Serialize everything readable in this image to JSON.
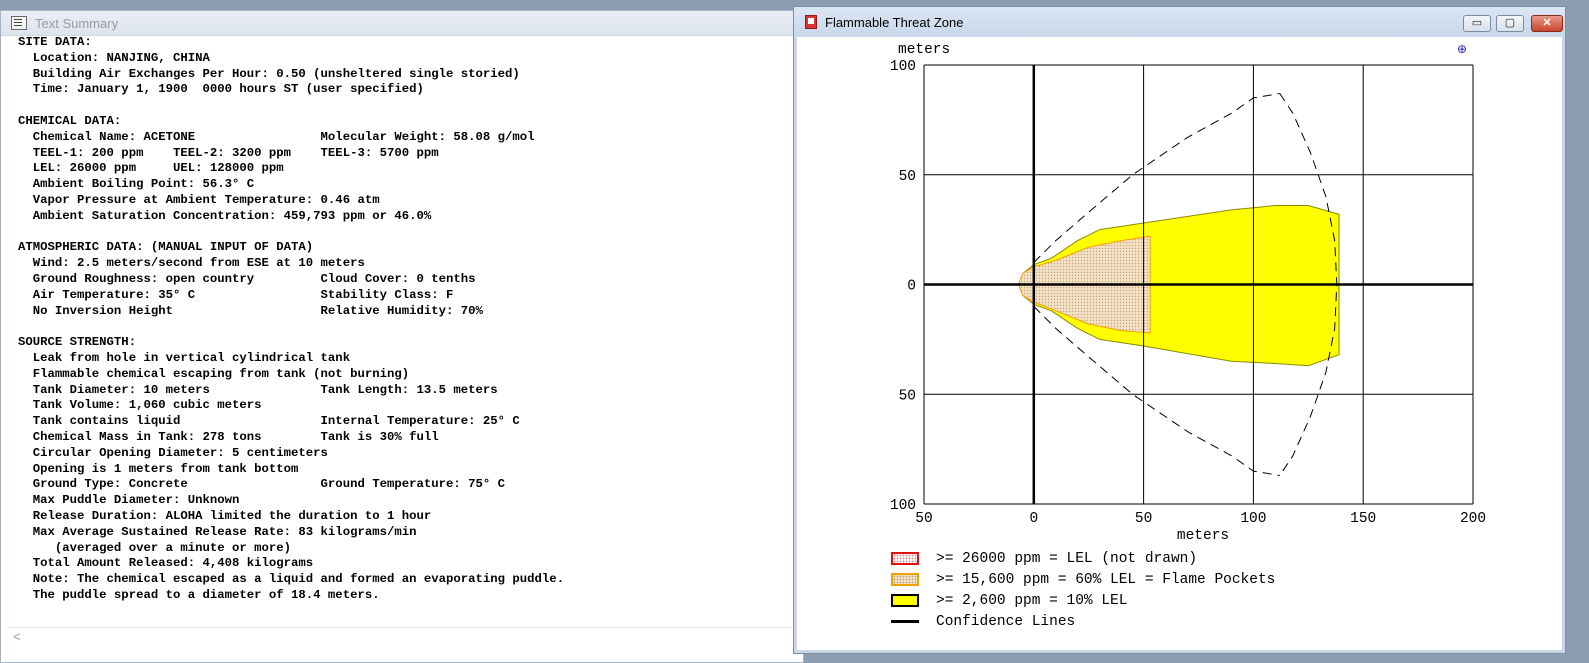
{
  "text_summary": {
    "title": "Text Summary",
    "report": "SITE DATA:\n  Location: NANJING, CHINA\n  Building Air Exchanges Per Hour: 0.50 (unsheltered single storied)\n  Time: January 1, 1900  0000 hours ST (user specified)\n\nCHEMICAL DATA:\n  Chemical Name: ACETONE                 Molecular Weight: 58.08 g/mol\n  TEEL-1: 200 ppm    TEEL-2: 3200 ppm    TEEL-3: 5700 ppm\n  LEL: 26000 ppm     UEL: 128000 ppm\n  Ambient Boiling Point: 56.3° C\n  Vapor Pressure at Ambient Temperature: 0.46 atm\n  Ambient Saturation Concentration: 459,793 ppm or 46.0%\n\nATMOSPHERIC DATA: (MANUAL INPUT OF DATA)\n  Wind: 2.5 meters/second from ESE at 10 meters\n  Ground Roughness: open country         Cloud Cover: 0 tenths\n  Air Temperature: 35° C                 Stability Class: F\n  No Inversion Height                    Relative Humidity: 70%\n\nSOURCE STRENGTH:\n  Leak from hole in vertical cylindrical tank\n  Flammable chemical escaping from tank (not burning)\n  Tank Diameter: 10 meters               Tank Length: 13.5 meters\n  Tank Volume: 1,060 cubic meters\n  Tank contains liquid                   Internal Temperature: 25° C\n  Chemical Mass in Tank: 278 tons        Tank is 30% full\n  Circular Opening Diameter: 5 centimeters\n  Opening is 1 meters from tank bottom\n  Ground Type: Concrete                  Ground Temperature: 75° C\n  Max Puddle Diameter: Unknown\n  Release Duration: ALOHA limited the duration to 1 hour\n  Max Average Sustained Release Rate: 83 kilograms/min\n     (averaged over a minute or more)\n  Total Amount Released: 4,408 kilograms\n  Note: The chemical escaped as a liquid and formed an evaporating puddle.\n  The puddle spread to a diameter of 18.4 meters.",
    "scroll_left_glyph": "<"
  },
  "threat_zone": {
    "title": "Flammable Threat Zone",
    "controls": {
      "minimize": "▭",
      "maximize": "▢",
      "close": "✕"
    },
    "compass_glyph": "⊕",
    "y_unit": "meters",
    "x_label": "meters",
    "y_ticks": [
      "100",
      "50",
      "0",
      "50",
      "100"
    ],
    "x_ticks": [
      "50",
      "0",
      "50",
      "100",
      "150",
      "200"
    ],
    "legend": [
      {
        "label": ">= 26000 ppm = LEL (not drawn)",
        "color": "#e01010"
      },
      {
        "label": ">= 15,600 ppm = 60% LEL = Flame Pockets",
        "color": "#f2a000"
      },
      {
        "label": ">= 2,600 ppm = 10% LEL",
        "color": "#ffff00"
      },
      {
        "label": "Confidence Lines",
        "color": "#000000"
      }
    ]
  },
  "chart_data": {
    "type": "area",
    "x_range": [
      -50,
      200
    ],
    "y_range": [
      -100,
      100
    ],
    "grid": true,
    "xlabel": "meters",
    "ylabel": "meters",
    "series": [
      {
        "name": ">= 2,600 ppm = 10% LEL",
        "color": "#ffff00",
        "outline": [
          [
            -7,
            0
          ],
          [
            -5,
            5
          ],
          [
            0,
            9
          ],
          [
            8,
            12
          ],
          [
            20,
            20
          ],
          [
            30,
            25
          ],
          [
            50,
            28
          ],
          [
            90,
            34
          ],
          [
            110,
            36
          ],
          [
            125,
            36
          ],
          [
            139,
            32
          ],
          [
            139,
            -32
          ],
          [
            125,
            -37
          ],
          [
            110,
            -36
          ],
          [
            90,
            -35
          ],
          [
            50,
            -28
          ],
          [
            30,
            -25
          ],
          [
            20,
            -20
          ],
          [
            8,
            -12
          ],
          [
            0,
            -9
          ],
          [
            -5,
            -5
          ]
        ]
      },
      {
        "name": ">= 15,600 ppm = 60% LEL = Flame Pockets",
        "color": "#f2a000",
        "outline": [
          [
            -7,
            0
          ],
          [
            -5,
            5
          ],
          [
            0,
            8
          ],
          [
            10,
            11
          ],
          [
            25,
            17
          ],
          [
            40,
            20
          ],
          [
            53,
            22
          ],
          [
            53,
            -22
          ],
          [
            40,
            -21
          ],
          [
            25,
            -18
          ],
          [
            10,
            -12
          ],
          [
            0,
            -8
          ],
          [
            -5,
            -5
          ]
        ]
      },
      {
        "name": "Confidence Lines",
        "color": "#000000",
        "style": "dashed",
        "upper": [
          [
            0,
            10
          ],
          [
            10,
            20
          ],
          [
            25,
            33
          ],
          [
            45,
            50
          ],
          [
            70,
            67
          ],
          [
            90,
            78
          ],
          [
            100,
            85
          ],
          [
            112,
            87
          ]
        ],
        "lower": [
          [
            0,
            -10
          ],
          [
            10,
            -20
          ],
          [
            25,
            -33
          ],
          [
            45,
            -50
          ],
          [
            70,
            -67
          ],
          [
            90,
            -78
          ],
          [
            100,
            -85
          ],
          [
            112,
            -87
          ]
        ],
        "arc": [
          [
            112,
            87
          ],
          [
            118,
            78
          ],
          [
            126,
            60
          ],
          [
            133,
            40
          ],
          [
            137,
            20
          ],
          [
            138,
            0
          ],
          [
            137,
            -20
          ],
          [
            133,
            -40
          ],
          [
            126,
            -60
          ],
          [
            118,
            -78
          ],
          [
            112,
            -87
          ]
        ]
      }
    ]
  }
}
